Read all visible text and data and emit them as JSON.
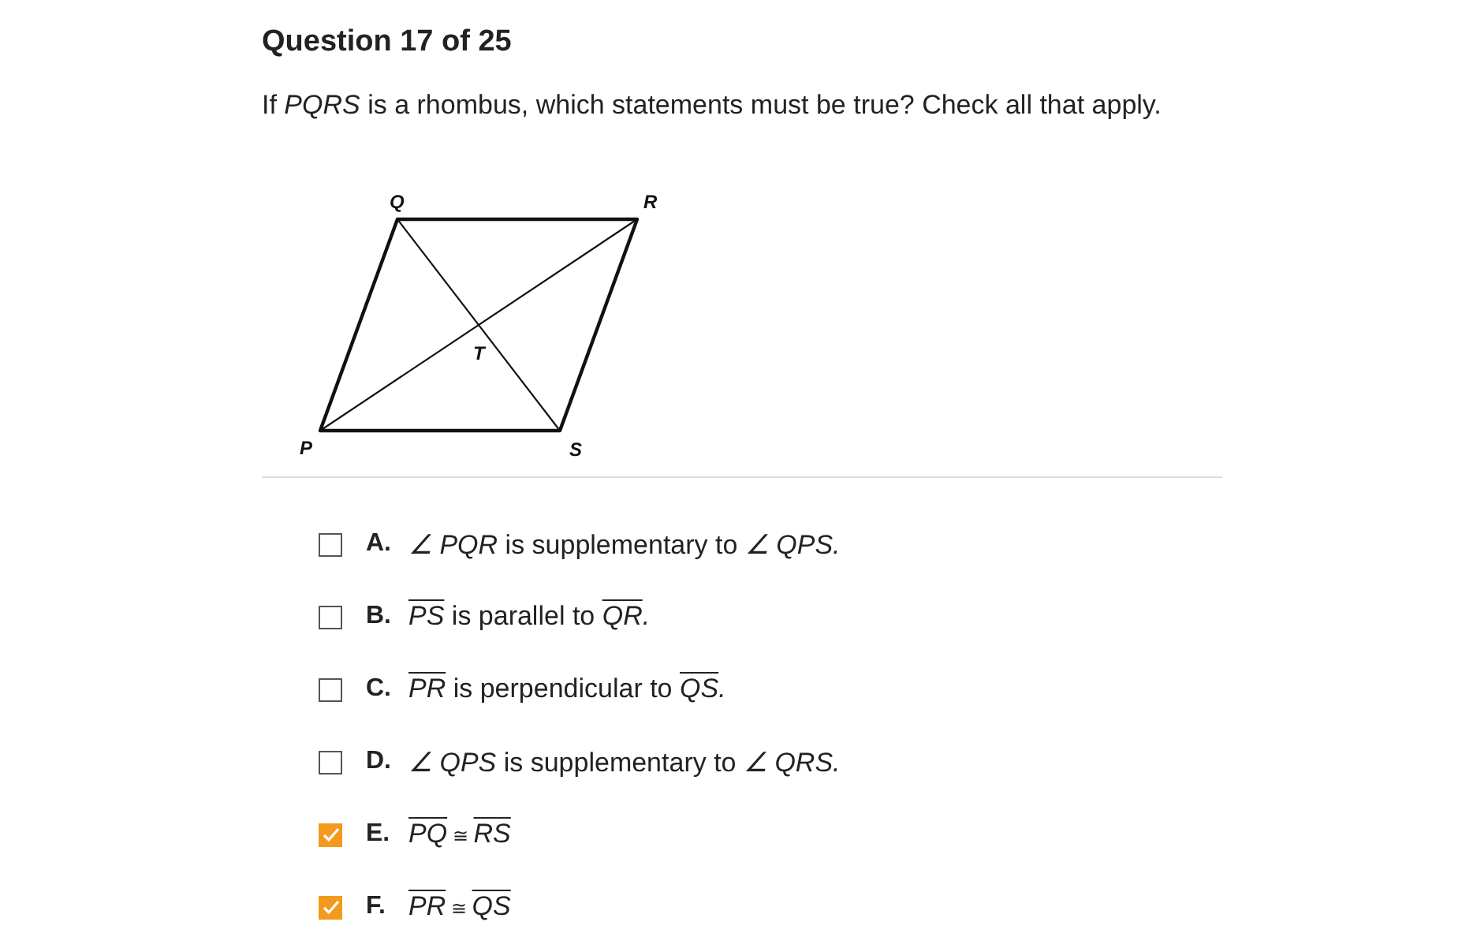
{
  "title": "Question 17 of 25",
  "question": [
    {
      "kind": "plain",
      "text": "If "
    },
    {
      "kind": "italic",
      "text": "PQRS"
    },
    {
      "kind": "plain",
      "text": " is a rhombus, which statements must be true? Check all that apply."
    }
  ],
  "diagram": {
    "labels": [
      "Q",
      "R",
      "P",
      "S",
      "T"
    ]
  },
  "options": [
    {
      "letter": "A.",
      "checked": false,
      "parts": [
        {
          "kind": "italic",
          "text": "∠ PQR"
        },
        {
          "kind": "plain",
          "text": " is supplementary to "
        },
        {
          "kind": "italic",
          "text": "∠ QPS."
        }
      ]
    },
    {
      "letter": "B.",
      "checked": false,
      "parts": [
        {
          "kind": "segment",
          "text": "PS"
        },
        {
          "kind": "plain",
          "text": " is parallel to "
        },
        {
          "kind": "segment",
          "text": "QR"
        },
        {
          "kind": "italic",
          "text": "."
        }
      ]
    },
    {
      "letter": "C.",
      "checked": false,
      "parts": [
        {
          "kind": "segment",
          "text": "PR"
        },
        {
          "kind": "plain",
          "text": " is perpendicular to "
        },
        {
          "kind": "segment",
          "text": "QS"
        },
        {
          "kind": "italic",
          "text": "."
        }
      ]
    },
    {
      "letter": "D.",
      "checked": false,
      "parts": [
        {
          "kind": "italic",
          "text": "∠ QPS"
        },
        {
          "kind": "plain",
          "text": " is supplementary to "
        },
        {
          "kind": "italic",
          "text": "∠ QRS."
        }
      ]
    },
    {
      "letter": "E.",
      "checked": true,
      "parts": [
        {
          "kind": "segment",
          "text": "PQ"
        },
        {
          "kind": "small",
          "text": " ≅ "
        },
        {
          "kind": "segment",
          "text": "RS"
        }
      ]
    },
    {
      "letter": "F.",
      "checked": true,
      "parts": [
        {
          "kind": "segment",
          "text": "PR"
        },
        {
          "kind": "small",
          "text": " ≅ "
        },
        {
          "kind": "segment",
          "text": "QS"
        }
      ]
    }
  ]
}
